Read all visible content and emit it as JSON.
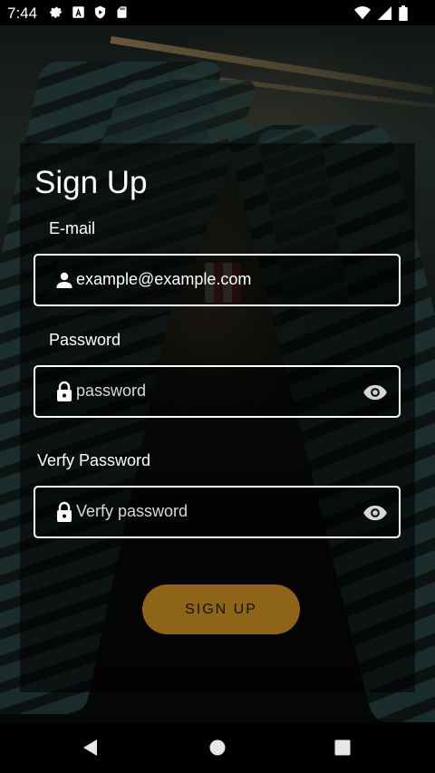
{
  "status_bar": {
    "time": "7:44",
    "left_icons": [
      "settings-icon",
      "font-a-icon",
      "shield-play-icon",
      "sd-card-icon"
    ],
    "right_icons": [
      "wifi-icon",
      "cell-signal-icon",
      "battery-icon"
    ]
  },
  "signup": {
    "title": "Sign Up",
    "email": {
      "label": "E-mail",
      "value": "example@example.com",
      "icon": "person-icon"
    },
    "password": {
      "label": "Password",
      "placeholder": "password",
      "icon": "lock-icon",
      "toggle_icon": "eye-icon"
    },
    "verify_password": {
      "label": "Verfy Password",
      "placeholder": "Verfy password",
      "icon": "lock-icon",
      "toggle_icon": "eye-icon"
    },
    "button_label": "SIGN UP",
    "accent_color": "#8e6418"
  },
  "nav_bar": {
    "buttons": [
      "back-icon",
      "home-icon",
      "recents-icon"
    ]
  }
}
